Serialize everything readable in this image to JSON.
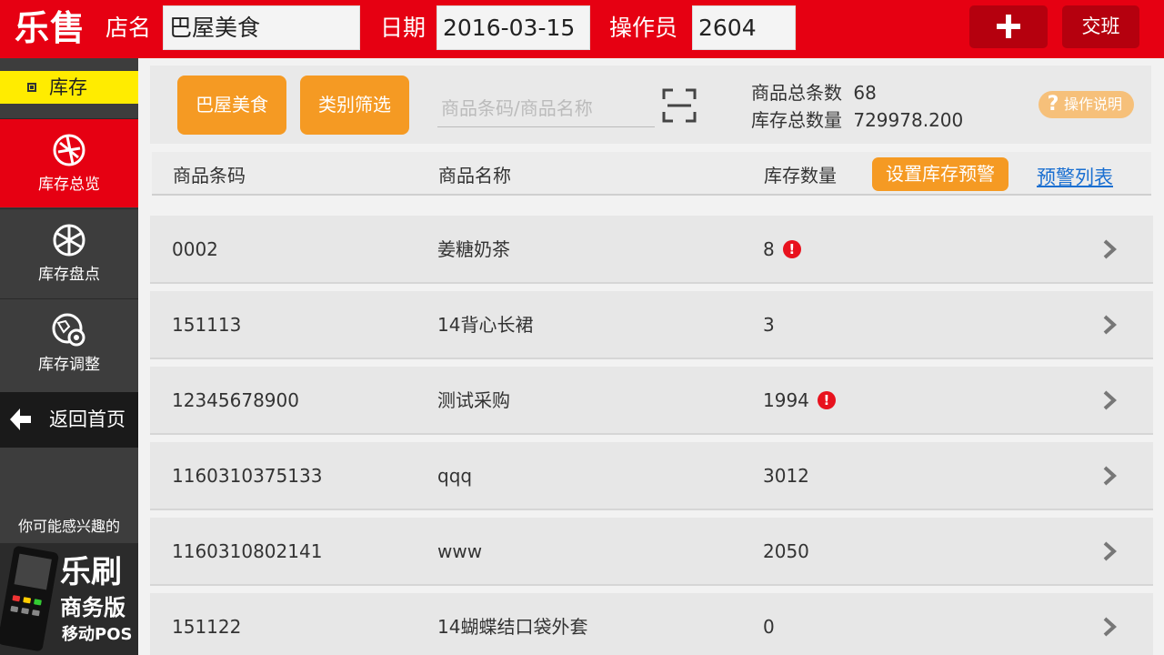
{
  "app": {
    "logo": "乐售"
  },
  "header": {
    "store_label": "店名",
    "store_value": "巴屋美食",
    "date_label": "日期",
    "date_value": "2016-03-15",
    "operator_label": "操作员",
    "operator_value": "2604",
    "add_icon": "plus-icon",
    "shift_label": "交班"
  },
  "sidebar": {
    "section": "库存",
    "items": [
      {
        "label": "库存总览",
        "icon": "overview-icon",
        "active": true
      },
      {
        "label": "库存盘点",
        "icon": "count-icon",
        "active": false
      },
      {
        "label": "库存调整",
        "icon": "adjust-icon",
        "active": false
      }
    ],
    "back": "返回首页",
    "promo_title": "你可能感兴趣的",
    "promo": {
      "line1": "乐刷",
      "line2": "商务版",
      "line3": "移动POS"
    }
  },
  "toolbar": {
    "store_button": "巴屋美食",
    "category_button": "类别筛选",
    "search_placeholder": "商品条码/商品名称",
    "total_items_label": "商品总条数",
    "total_items_value": "68",
    "total_qty_label": "库存总数量",
    "total_qty_value": "729978.200",
    "help_label": "操作说明"
  },
  "table": {
    "columns": [
      "商品条码",
      "商品名称",
      "库存数量"
    ],
    "set_warning_button": "设置库存预警",
    "warning_list_link": "预警列表",
    "rows": [
      {
        "code": "0002",
        "name": "姜糖奶茶",
        "qty": "8",
        "alert": true
      },
      {
        "code": "151113",
        "name": "14背心长裙",
        "qty": "3",
        "alert": false
      },
      {
        "code": "12345678900",
        "name": "测试采购",
        "qty": "1994",
        "alert": true
      },
      {
        "code": "1160310375133",
        "name": "qqq",
        "qty": "3012",
        "alert": false
      },
      {
        "code": "1160310802141",
        "name": "www",
        "qty": "2050",
        "alert": false
      },
      {
        "code": "151122",
        "name": "14蝴蝶结口袋外套",
        "qty": "0",
        "alert": false
      }
    ]
  },
  "colors": {
    "brand_red": "#e60012",
    "accent_orange": "#f59a23",
    "alert_red": "#e8121e",
    "section_yellow": "#ffec00",
    "link_blue": "#1a6fd1"
  }
}
